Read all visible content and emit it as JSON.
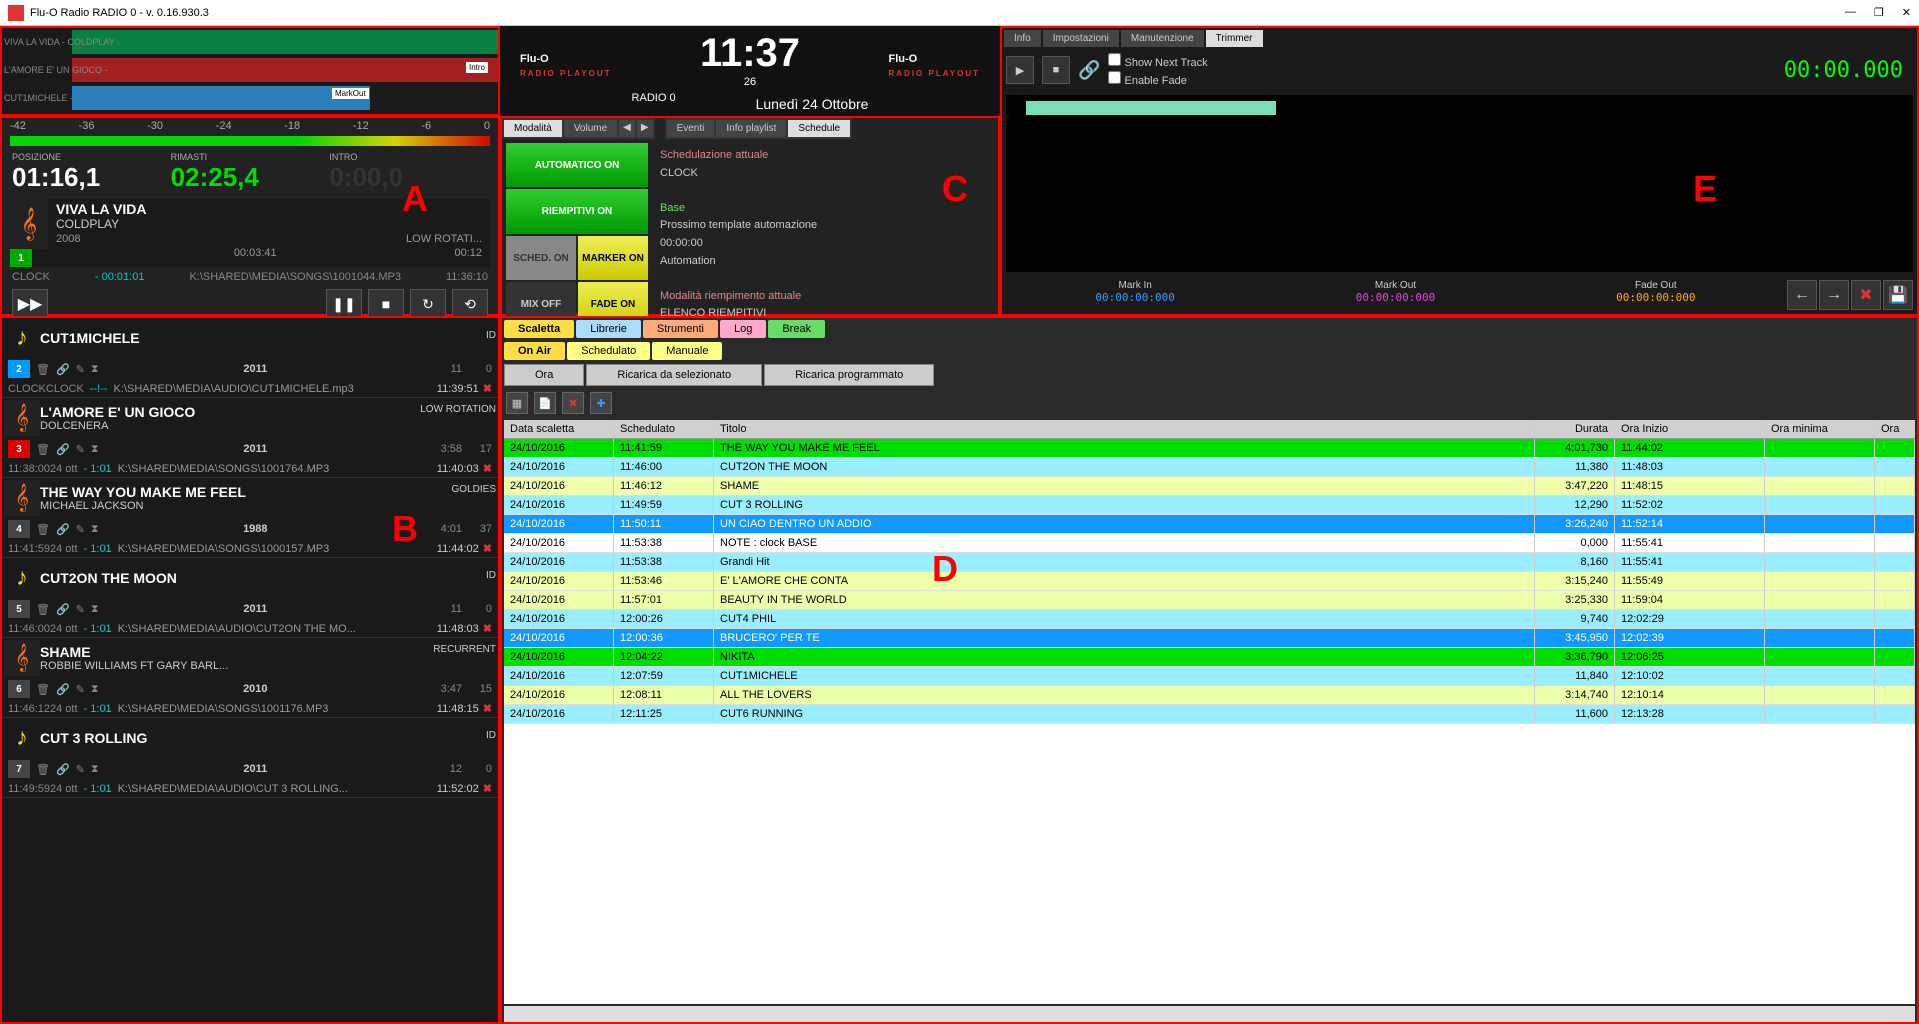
{
  "window": {
    "title": "Flu-O Radio RADIO 0 - v. 0.16.930.3"
  },
  "waveform": {
    "tracks": [
      {
        "label": "VIVA LA VIDA - COLDPLAY"
      },
      {
        "label": "L'AMORE E' UN GIOCO -",
        "tag": "Intro"
      },
      {
        "label": "CUT1MICHELE -",
        "tag": "MarkOut"
      }
    ]
  },
  "clock": {
    "brand": "Flu-O",
    "sub": "RADIO PLAYOUT",
    "time": "11:37",
    "sec": "26",
    "station": "RADIO 0",
    "date": "Lunedì 24  Ottobre"
  },
  "panelA": {
    "db": [
      "-42",
      "-36",
      "-30",
      "-24",
      "-18",
      "-12",
      "-6",
      "0"
    ],
    "pos_lbl": "POSIZIONE",
    "pos": "01:16,1",
    "rem_lbl": "RIMASTI",
    "rem": "02:25,4",
    "intro_lbl": "INTRO",
    "intro": "0:00,0",
    "title": "VIVA LA VIDA",
    "artist": "COLDPLAY",
    "year": "2008",
    "cat": "LOW ROTATI...",
    "dur": "00:03:41",
    "rot": "00:12",
    "src": "CLOCK",
    "neg": "- 00:01:01",
    "path": "K:\\SHARED\\MEDIA\\SONGS\\1001044.MP3",
    "eta": "11:36:10",
    "num": "1",
    "letter": "A"
  },
  "panelC": {
    "tabs1": [
      "Modalità",
      "Volume"
    ],
    "tabs2": [
      "Eventi",
      "Info playlist",
      "Schedule"
    ],
    "btns": {
      "auto": "AUTOMATICO ON",
      "riemp": "RIEMPITIVI ON",
      "sched": "SCHED. ON",
      "marker": "MARKER ON",
      "mix": "MIX OFF",
      "fade": "FADE ON"
    },
    "info": {
      "h1": "Schedulazione attuale",
      "v1": "CLOCK",
      "h2": "Base",
      "l2": "Prossimo template automazione",
      "t2": "00:00:00",
      "m2": "Automation",
      "h3": "Modalità riempimento attuale",
      "v3": "ELENCO RIEMPITIVI"
    },
    "letter": "C"
  },
  "queue": [
    {
      "icon": "note",
      "num": "2",
      "numc": "blue",
      "title": "CUT1MICHELE",
      "artist": "",
      "cat": "ID",
      "year": "2011",
      "dur": "11",
      "rot": "0",
      "src": "CLOCK",
      "neg": "--!--",
      "path": "K:\\SHARED\\MEDIA\\AUDIO\\CUT1MICHELE.mp3",
      "eta": "11:39:51"
    },
    {
      "icon": "clef",
      "num": "3",
      "numc": "red",
      "title": "L'AMORE E' UN GIOCO",
      "artist": "DOLCENERA",
      "cat": "LOW ROTATION",
      "year": "2011",
      "dur": "3:58",
      "rot": "17",
      "src": "24 ott",
      "neg": "- 1:01",
      "path": "K:\\SHARED\\MEDIA\\SONGS\\1001764.MP3",
      "eta": "11:40:03",
      "pre": "11:38:00"
    },
    {
      "icon": "clef",
      "num": "4",
      "numc": "gray",
      "title": "THE WAY YOU MAKE ME FEEL",
      "artist": "MICHAEL JACKSON",
      "cat": "GOLDIES",
      "year": "1988",
      "dur": "4:01",
      "rot": "37",
      "src": "24 ott",
      "neg": "- 1:01",
      "path": "K:\\SHARED\\MEDIA\\SONGS\\1000157.MP3",
      "eta": "11:44:02",
      "pre": "11:41:59"
    },
    {
      "icon": "note",
      "num": "5",
      "numc": "gray",
      "title": "CUT2ON THE MOON",
      "artist": "",
      "cat": "ID",
      "year": "2011",
      "dur": "11",
      "rot": "0",
      "src": "24 ott",
      "neg": "- 1:01",
      "path": "K:\\SHARED\\MEDIA\\AUDIO\\CUT2ON THE MO...",
      "eta": "11:48:03",
      "pre": "11:46:00"
    },
    {
      "icon": "clef",
      "num": "6",
      "numc": "gray",
      "title": "SHAME",
      "artist": "ROBBIE WILLIAMS FT GARY BARL...",
      "cat": "RECURRENT",
      "year": "2010",
      "dur": "3:47",
      "rot": "15",
      "src": "24 ott",
      "neg": "- 1:01",
      "path": "K:\\SHARED\\MEDIA\\SONGS\\1001176.MP3",
      "eta": "11:48:15",
      "pre": "11:46:12"
    },
    {
      "icon": "note",
      "num": "7",
      "numc": "gray",
      "title": "CUT 3 ROLLING",
      "artist": "",
      "cat": "ID",
      "year": "2011",
      "dur": "12",
      "rot": "0",
      "src": "24 ott",
      "neg": "- 1:01",
      "path": "K:\\SHARED\\MEDIA\\AUDIO\\CUT 3 ROLLING...",
      "eta": "11:52:02",
      "pre": "11:49:59"
    }
  ],
  "panelB": {
    "letter": "B"
  },
  "panelE": {
    "tabs": [
      "Info",
      "Impostazioni",
      "Manutenzione",
      "Trimmer"
    ],
    "chk1": "Show Next Track",
    "chk2": "Enable Fade",
    "time": "00:00.000",
    "marks": [
      {
        "l": "Mark In",
        "v": "00:00:00:000",
        "c": "blue"
      },
      {
        "l": "Mark Out",
        "v": "00:00:00:000",
        "c": "mag"
      },
      {
        "l": "Fade Out",
        "v": "00:00:00:000",
        "c": "orng"
      }
    ],
    "letter": "E"
  },
  "panelD": {
    "tabs1": [
      {
        "l": "Scaletta",
        "c": "yel"
      },
      {
        "l": "Librerie",
        "c": "blu"
      },
      {
        "l": "Strumenti",
        "c": "orng"
      },
      {
        "l": "Log",
        "c": "pnk"
      },
      {
        "l": "Break",
        "c": "grn"
      }
    ],
    "tabs2": [
      {
        "l": "On Air",
        "c": "yel"
      },
      {
        "l": "Schedulato",
        "c": "ylw"
      },
      {
        "l": "Manuale",
        "c": "ylw"
      }
    ],
    "btns": [
      "Ora",
      "Ricarica da selezionato",
      "Ricarica programmato"
    ],
    "cols": [
      "Data scaletta",
      "Schedulato",
      "Titolo",
      "Durata",
      "Ora Inizio",
      "Ora minima",
      "Ora"
    ],
    "rows": [
      {
        "c": "g",
        "d": "24/10/2016",
        "s": "11:41:59",
        "t": "THE WAY YOU MAKE ME FEEL",
        "du": "4:01,730",
        "oi": "11:44:02"
      },
      {
        "c": "c",
        "d": "24/10/2016",
        "s": "11:46:00",
        "t": "CUT2ON THE MOON",
        "du": "11,380",
        "oi": "11:48:03"
      },
      {
        "c": "y",
        "d": "24/10/2016",
        "s": "11:46:12",
        "t": "SHAME",
        "du": "3:47,220",
        "oi": "11:48:15"
      },
      {
        "c": "c",
        "d": "24/10/2016",
        "s": "11:49:59",
        "t": "CUT 3 ROLLING",
        "du": "12,290",
        "oi": "11:52:02"
      },
      {
        "c": "b",
        "d": "24/10/2016",
        "s": "11:50:11",
        "t": "UN CIAO DENTRO UN ADDIO",
        "du": "3:26,240",
        "oi": "11:52:14"
      },
      {
        "c": "w",
        "d": "24/10/2016",
        "s": "11:53:38",
        "t": "NOTE : clock BASE",
        "du": "0,000",
        "oi": "11:55:41"
      },
      {
        "c": "c",
        "d": "24/10/2016",
        "s": "11:53:38",
        "t": "Grandi Hit",
        "du": "8,160",
        "oi": "11:55:41"
      },
      {
        "c": "y",
        "d": "24/10/2016",
        "s": "11:53:46",
        "t": "E' L'AMORE CHE CONTA",
        "du": "3:15,240",
        "oi": "11:55:49"
      },
      {
        "c": "y",
        "d": "24/10/2016",
        "s": "11:57:01",
        "t": "BEAUTY IN THE WORLD",
        "du": "3:25,330",
        "oi": "11:59:04"
      },
      {
        "c": "c",
        "d": "24/10/2016",
        "s": "12:00:26",
        "t": "CUT4 PHIL",
        "du": "9,740",
        "oi": "12:02:29"
      },
      {
        "c": "b",
        "d": "24/10/2016",
        "s": "12:00:36",
        "t": "BRUCERO' PER TE",
        "du": "3:45,950",
        "oi": "12:02:39"
      },
      {
        "c": "g",
        "d": "24/10/2016",
        "s": "12:04:22",
        "t": "NIKITA",
        "du": "3:36,790",
        "oi": "12:06:25"
      },
      {
        "c": "c",
        "d": "24/10/2016",
        "s": "12:07:59",
        "t": "CUT1MICHELE",
        "du": "11,840",
        "oi": "12:10:02"
      },
      {
        "c": "y",
        "d": "24/10/2016",
        "s": "12:08:11",
        "t": "ALL THE LOVERS",
        "du": "3:14,740",
        "oi": "12:10:14"
      },
      {
        "c": "c",
        "d": "24/10/2016",
        "s": "12:11:25",
        "t": "CUT6 RUNNING",
        "du": "11,600",
        "oi": "12:13:28"
      }
    ],
    "letter": "D"
  }
}
